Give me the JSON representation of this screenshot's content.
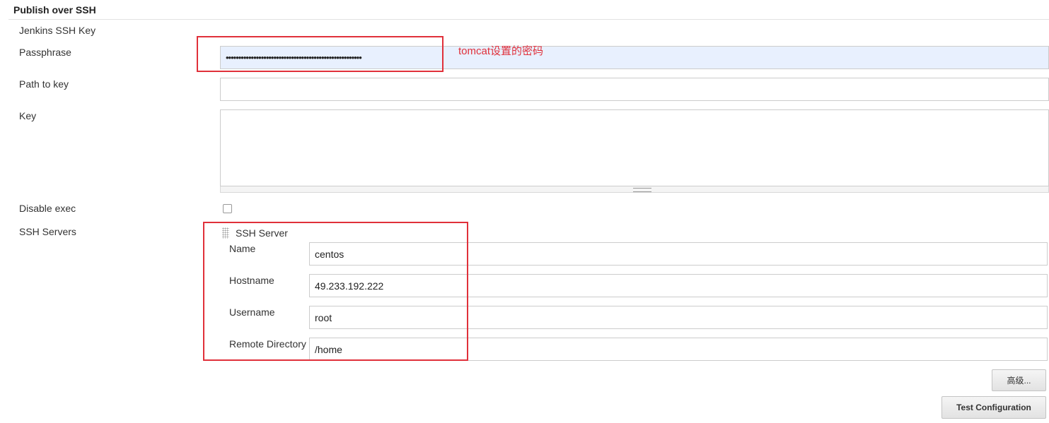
{
  "section": {
    "title": "Publish over SSH"
  },
  "labels": {
    "jenkins_ssh_key": "Jenkins SSH Key",
    "passphrase": "Passphrase",
    "path_to_key": "Path to key",
    "key": "Key",
    "disable_exec": "Disable exec",
    "ssh_servers": "SSH Servers"
  },
  "fields": {
    "passphrase_value": "••••••••••••••••••••••••••••••••••••••••••••••••••••••",
    "path_to_key_value": "",
    "key_value": "",
    "disable_exec_checked": false
  },
  "annotation": {
    "text": "tomcat设置的密码",
    "color": "#e0303a"
  },
  "ssh_server": {
    "header": "SSH Server",
    "name_label": "Name",
    "name_value": "centos",
    "hostname_label": "Hostname",
    "hostname_value": "49.233.192.222",
    "username_label": "Username",
    "username_value": "root",
    "remote_directory_label": "Remote Directory",
    "remote_directory_value": "/home"
  },
  "buttons": {
    "advanced": "高级...",
    "test_configuration": "Test Configuration"
  },
  "colors": {
    "highlight_border": "#e0303a",
    "autofill_background": "#e8f0fe"
  }
}
